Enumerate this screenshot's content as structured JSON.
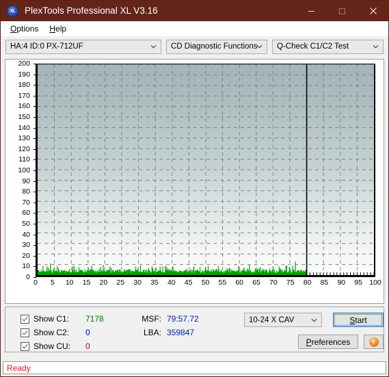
{
  "window": {
    "title": "PlexTools Professional XL V3.16",
    "icon_label": "XL",
    "minimize_icon": "minimize-icon",
    "maximize_icon": "maximize-icon",
    "close_icon": "close-icon",
    "titlebar_color": "#63251a"
  },
  "menu": {
    "items": [
      {
        "label": "Options",
        "accel": "O"
      },
      {
        "label": "Help",
        "accel": "H"
      }
    ]
  },
  "toolbar": {
    "drive_select": "HA:4 ID:0  PX-712UF",
    "function_select": "CD Diagnostic Functions",
    "test_select": "Q-Check C1/C2 Test"
  },
  "controls": {
    "checkboxes": [
      {
        "label": "Show C1:",
        "checked": true,
        "value": "7178",
        "color": "#008000"
      },
      {
        "label": "Show C2:",
        "checked": true,
        "value": "0",
        "color": "#0000c8"
      },
      {
        "label": "Show CU:",
        "checked": true,
        "value": "0",
        "color": "#d40000"
      }
    ],
    "readouts": [
      {
        "key": "MSF:",
        "value": "79:57.72"
      },
      {
        "key": "LBA:",
        "value": "359847"
      }
    ],
    "speed_select": "10-24 X CAV",
    "start_label": "Start",
    "start_accel": "S",
    "preferences_label": "Preferences",
    "preferences_accel": "P",
    "info_label": "i"
  },
  "statusbar": {
    "text": "Ready"
  },
  "chart_data": {
    "type": "bar",
    "title": "",
    "xlabel": "",
    "ylabel": "",
    "xlim": [
      0,
      100
    ],
    "ylim": [
      0,
      200
    ],
    "ytick_step": 10,
    "xtick_step": 5,
    "xticks": [
      0,
      5,
      10,
      15,
      20,
      25,
      30,
      35,
      40,
      45,
      50,
      55,
      60,
      65,
      70,
      75,
      80,
      85,
      90,
      95,
      100
    ],
    "yticks": [
      0,
      10,
      20,
      30,
      40,
      50,
      60,
      70,
      80,
      90,
      100,
      110,
      120,
      130,
      140,
      150,
      160,
      170,
      180,
      190,
      200
    ],
    "grid": true,
    "grid_style": "dashed",
    "grid_color": "#808080",
    "background_gradient": [
      "#a2b4b7",
      "#fcfdfd"
    ],
    "data_end_x": 80,
    "marker_line_x": 80,
    "series": [
      {
        "name": "C1",
        "color": "#00a000",
        "comment": "C1 error rate per disc position; dense spiky data from 0 to 80, baseline ~2-6, peaks to ~24",
        "x": [
          0.0,
          0.4,
          0.8,
          1.2,
          1.6,
          2.0,
          2.4,
          2.8,
          3.2,
          3.6,
          4.0,
          4.4,
          4.8,
          5.2,
          5.6,
          6.0,
          6.4,
          6.8,
          7.2,
          7.6,
          8.0,
          8.4,
          8.8,
          9.2,
          9.6,
          10.0,
          10.4,
          10.8,
          11.2,
          11.6,
          12.0,
          12.4,
          12.8,
          13.2,
          13.6,
          14.0,
          14.4,
          14.8,
          15.2,
          15.6,
          16.0,
          16.4,
          16.8,
          17.2,
          17.6,
          18.0,
          18.4,
          18.8,
          19.2,
          19.6,
          20.0,
          20.4,
          20.8,
          21.2,
          21.6,
          22.0,
          22.4,
          22.8,
          23.2,
          23.6,
          24.0,
          24.4,
          24.8,
          25.2,
          25.6,
          26.0,
          26.4,
          26.8,
          27.2,
          27.6,
          28.0,
          28.4,
          28.8,
          29.2,
          29.6,
          30.0,
          30.4,
          30.8,
          31.2,
          31.6,
          32.0,
          32.4,
          32.8,
          33.2,
          33.6,
          34.0,
          34.4,
          34.8,
          35.2,
          35.6,
          36.0,
          36.4,
          36.8,
          37.2,
          37.6,
          38.0,
          38.4,
          38.8,
          39.2,
          39.6,
          40.0,
          40.4,
          40.8,
          41.2,
          41.6,
          42.0,
          42.4,
          42.8,
          43.2,
          43.6,
          44.0,
          44.4,
          44.8,
          45.2,
          45.6,
          46.0,
          46.4,
          46.8,
          47.2,
          47.6,
          48.0,
          48.4,
          48.8,
          49.2,
          49.6,
          50.0,
          50.4,
          50.8,
          51.2,
          51.6,
          52.0,
          52.4,
          52.8,
          53.2,
          53.6,
          54.0,
          54.4,
          54.8,
          55.2,
          55.6,
          56.0,
          56.4,
          56.8,
          57.2,
          57.6,
          58.0,
          58.4,
          58.8,
          59.2,
          59.6,
          60.0,
          60.4,
          60.8,
          61.2,
          61.6,
          62.0,
          62.4,
          62.8,
          63.2,
          63.6,
          64.0,
          64.4,
          64.8,
          65.2,
          65.6,
          66.0,
          66.4,
          66.8,
          67.2,
          67.6,
          68.0,
          68.4,
          68.8,
          69.2,
          69.6,
          70.0,
          70.4,
          70.8,
          71.2,
          71.6,
          72.0,
          72.4,
          72.8,
          73.2,
          73.6,
          74.0,
          74.4,
          74.8,
          75.2,
          75.6,
          76.0,
          76.4,
          76.8,
          77.2,
          77.6,
          78.0,
          78.4,
          78.8,
          79.2,
          79.6,
          80.0
        ],
        "values": [
          5,
          4,
          6,
          3,
          5,
          4,
          13,
          6,
          4,
          8,
          5,
          14,
          7,
          5,
          4,
          6,
          12,
          5,
          7,
          4,
          9,
          5,
          4,
          7,
          16,
          5,
          4,
          6,
          24,
          8,
          5,
          13,
          6,
          4,
          7,
          5,
          9,
          4,
          6,
          5,
          12,
          7,
          4,
          6,
          5,
          8,
          4,
          14,
          6,
          5,
          4,
          7,
          5,
          9,
          4,
          6,
          5,
          11,
          4,
          6,
          5,
          8,
          4,
          5,
          7,
          4,
          6,
          5,
          9,
          4,
          5,
          12,
          6,
          4,
          5,
          7,
          4,
          6,
          5,
          8,
          4,
          5,
          9,
          4,
          6,
          5,
          7,
          4,
          5,
          14,
          6,
          4,
          5,
          8,
          4,
          6,
          5,
          7,
          4,
          5,
          11,
          6,
          4,
          5,
          9,
          4,
          6,
          5,
          8,
          4,
          5,
          7,
          4,
          6,
          5,
          13,
          4,
          5,
          8,
          4,
          6,
          5,
          7,
          4,
          5,
          9,
          4,
          6,
          5,
          8,
          4,
          5,
          7,
          4,
          6,
          5,
          11,
          4,
          5,
          8,
          4,
          6,
          5,
          7,
          4,
          5,
          9,
          4,
          6,
          5,
          8,
          4,
          5,
          12,
          4,
          6,
          5,
          7,
          4,
          5,
          9,
          4,
          6,
          5,
          8,
          4,
          5,
          7,
          4,
          6,
          5,
          11,
          4,
          5,
          8,
          4,
          6,
          5,
          7,
          4,
          5,
          9,
          4,
          6,
          5,
          8,
          4,
          5,
          7,
          4,
          6,
          5,
          13,
          4,
          5,
          8,
          4,
          6,
          5,
          7,
          4,
          5,
          9,
          6,
          5,
          4,
          3
        ]
      },
      {
        "name": "C2",
        "color": "#0000c8",
        "x": [],
        "values": []
      },
      {
        "name": "CU",
        "color": "#d40000",
        "x": [],
        "values": []
      }
    ]
  }
}
